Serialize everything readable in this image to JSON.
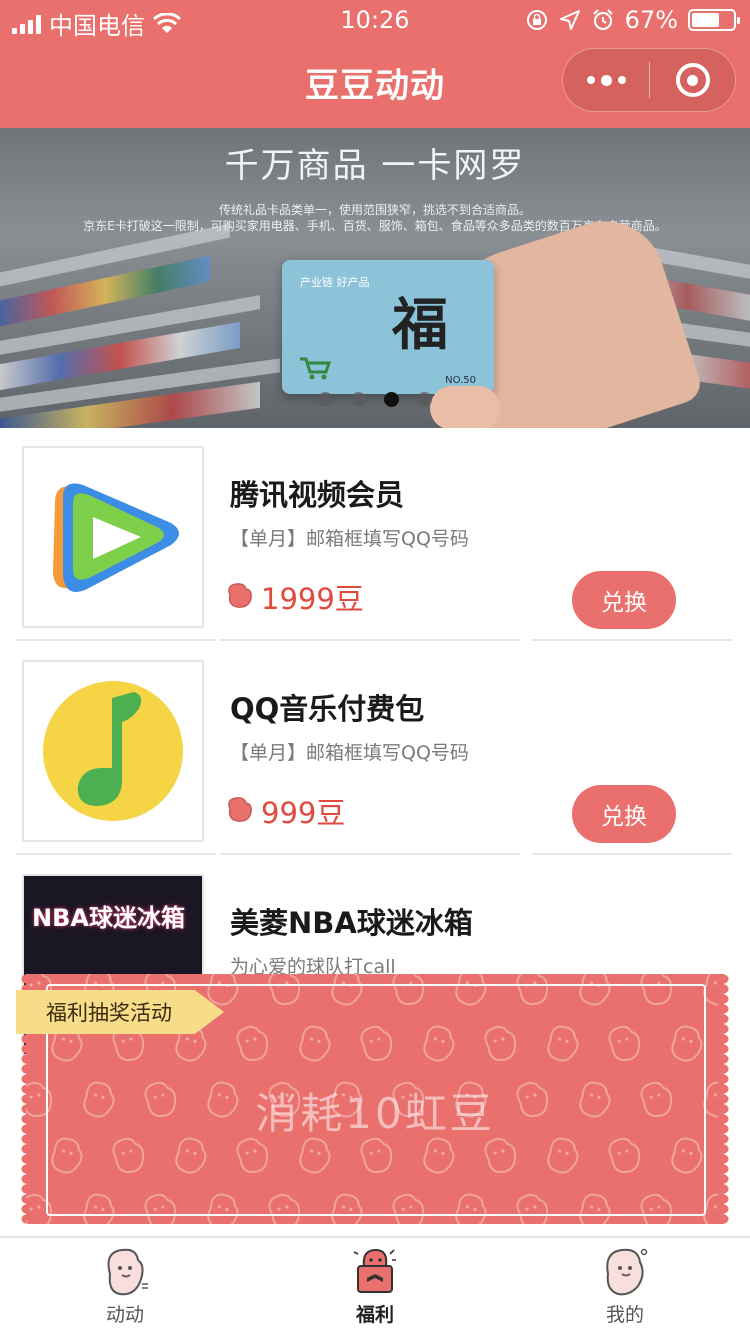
{
  "status_bar": {
    "carrier": "中国电信",
    "time": "10:26",
    "battery_percent": "67%",
    "battery_level": 0.67
  },
  "nav": {
    "title": "豆豆动动"
  },
  "banner": {
    "headline": "千万商品 一卡网罗",
    "subline_1": "传统礼品卡品类单一，使用范围狭窄，挑选不到合适商品。",
    "subline_2": "京东E卡打破这一限制，可购买家用电器、手机、百货、服饰、箱包、食品等众多品类的数百万京东自营商品。",
    "card_fu": "福",
    "card_line": "产业链 好产品",
    "card_no": "NO.50",
    "active_slide": 3,
    "slide_count": 4
  },
  "products": [
    {
      "title": "腾讯视频会员",
      "desc": "【单月】邮箱框填写QQ号码",
      "price": "1999豆",
      "button": "兑换"
    },
    {
      "title": "QQ音乐付费包",
      "desc": "【单月】邮箱框填写QQ号码",
      "price": "999豆",
      "button": "兑换"
    },
    {
      "title": "美菱NBA球迷冰箱",
      "desc": "为心爱的球队打call",
      "price": "",
      "button": "",
      "thumb_text": "NBA球迷冰箱"
    }
  ],
  "lottery": {
    "tag": "福利抽奖活动",
    "cost_text": "消耗10虹豆"
  },
  "tabs": [
    {
      "label": "动动",
      "icon": "bean-mascot-icon",
      "active": false
    },
    {
      "label": "福利",
      "icon": "gift-bean-icon",
      "active": true
    },
    {
      "label": "我的",
      "icon": "profile-bean-icon",
      "active": false
    }
  ],
  "colors": {
    "brand": "#e9706c",
    "price": "#e04a3f",
    "tag": "#f7dc8a"
  }
}
